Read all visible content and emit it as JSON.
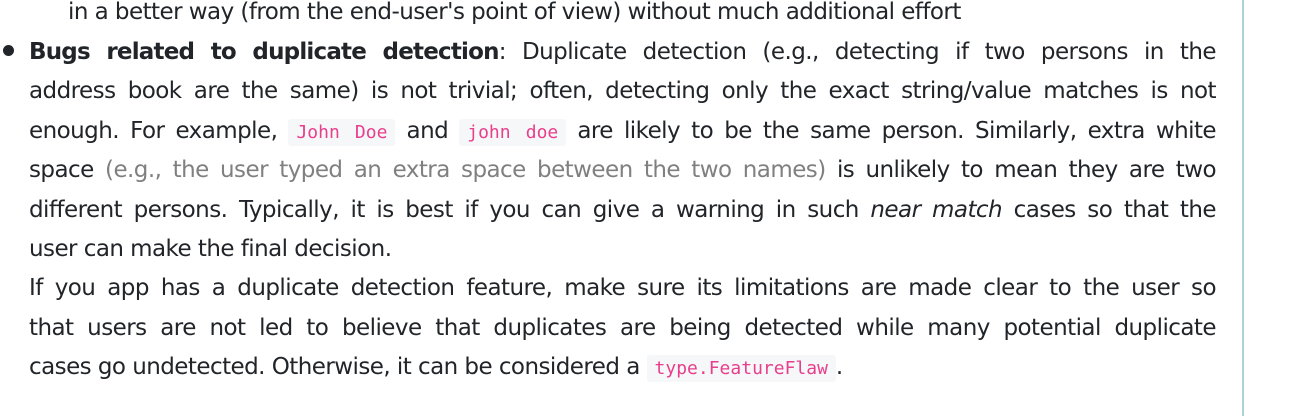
{
  "lines": {
    "l0": "in a better way (from the end-user's point of view) without much additional effort",
    "l1_bold": "Bugs related to duplicate detection",
    "l1_rest": ": Duplicate detection (e.g., detecting if two persons in the",
    "l2": "address book are the same) is not trivial; often, detecting only the exact string/value matches is not",
    "l3_a": "enough. For example,",
    "l3_code1": "John Doe",
    "l3_b": "and",
    "l3_code2": "john doe",
    "l3_c": "are likely to be the same person. Similarly, extra white",
    "l4_a": "space",
    "l4_muted": "(e.g., the user typed an extra space between the two names)",
    "l4_b": "is unlikely to mean they are two",
    "l5_a": "different persons. Typically, it is best if you can give a warning in such",
    "l5_italic": "near match",
    "l5_b": "cases so that the",
    "l6": "user can make the final decision.",
    "l7": "If you app has a duplicate detection feature, make sure its limitations are made clear to the user so",
    "l8": "that users are not led to believe that duplicates are being detected while many potential duplicate",
    "l9_a": "cases go undetected. Otherwise, it can be considered a",
    "l9_code": "type.FeatureFlaw",
    "l9_b": "."
  }
}
